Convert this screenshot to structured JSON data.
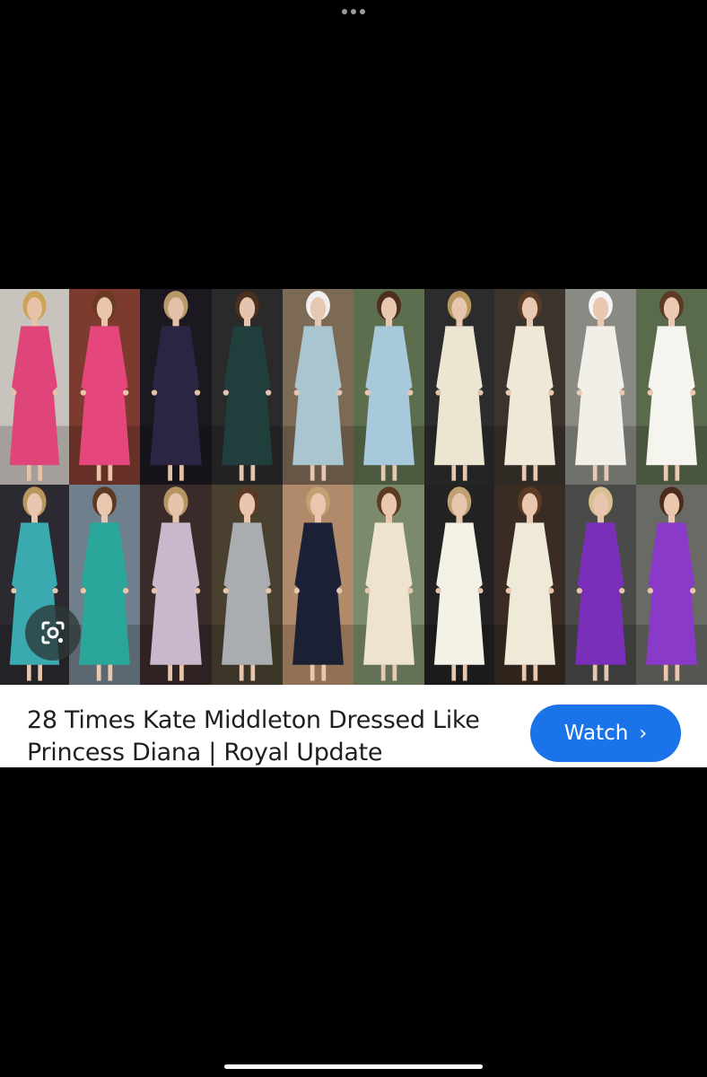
{
  "browser": {
    "menu_icon": "more-dots-icon"
  },
  "result": {
    "title": "28 Times Kate Middleton Dressed Like Princess Diana | Royal Update",
    "watch_label": "Watch",
    "watch_chevron": "›",
    "lens_icon": "google-lens-icon"
  },
  "collage": {
    "top_row": [
      {
        "bg": "#c9c3bd",
        "dress": "#e0457a",
        "skin": "#e8c2a8",
        "hair": "#c9a45a"
      },
      {
        "bg": "#7d3b2f",
        "dress": "#e5467c",
        "skin": "#eac5ac",
        "hair": "#6b3a22"
      },
      {
        "bg": "#1c1820",
        "dress": "#2a2542",
        "skin": "#e3c0a8",
        "hair": "#b89a68"
      },
      {
        "bg": "#2a2a2a",
        "dress": "#1f3e3c",
        "skin": "#e4c4ae",
        "hair": "#4a2e1e"
      },
      {
        "bg": "#7c6a55",
        "dress": "#a9c5cf",
        "skin": "#e6c7b2",
        "hair": "#efefef"
      },
      {
        "bg": "#5c6e4e",
        "dress": "#a8c9dc",
        "skin": "#e8c8b0",
        "hair": "#4e2f1e"
      },
      {
        "bg": "#2c2c2c",
        "dress": "#ece5d2",
        "skin": "#e6c6ae",
        "hair": "#b8955c"
      },
      {
        "bg": "#3a342c",
        "dress": "#efe8d6",
        "skin": "#eac9b2",
        "hair": "#5a3a26"
      },
      {
        "bg": "#8a8a84",
        "dress": "#f2efe8",
        "skin": "#e8c8b0",
        "hair": "#f4f4f4"
      },
      {
        "bg": "#5a6a4c",
        "dress": "#f6f4ef",
        "skin": "#ecc9b0",
        "hair": "#5c3a24"
      }
    ],
    "bottom_row": [
      {
        "bg": "#2a2a30",
        "dress": "#3aaab0",
        "skin": "#e6c6ae",
        "hair": "#b8955c"
      },
      {
        "bg": "#6f7f8c",
        "dress": "#2aa69a",
        "skin": "#eac8b0",
        "hair": "#5c3a24"
      },
      {
        "bg": "#3a2a2a",
        "dress": "#c9b8cc",
        "skin": "#e6c4ac",
        "hair": "#b89560"
      },
      {
        "bg": "#4a4030",
        "dress": "#a9adb0",
        "skin": "#e8c6ae",
        "hair": "#5a3a26"
      },
      {
        "bg": "#b08a6a",
        "dress": "#1c2034",
        "skin": "#eac6ae",
        "hair": "#c2a070"
      },
      {
        "bg": "#7a8a6a",
        "dress": "#eee3cf",
        "skin": "#eac8b0",
        "hair": "#5c3a24"
      },
      {
        "bg": "#222222",
        "dress": "#f4f1e6",
        "skin": "#e6c6ae",
        "hair": "#c0a070"
      },
      {
        "bg": "#3a2c22",
        "dress": "#efe9d8",
        "skin": "#eac8b0",
        "hair": "#5c3a24"
      },
      {
        "bg": "#4a4a48",
        "dress": "#7a2fb8",
        "skin": "#e6c6ae",
        "hair": "#d8c090"
      },
      {
        "bg": "#6a6a64",
        "dress": "#8a3ac8",
        "skin": "#eac8b0",
        "hair": "#4a2c1c"
      }
    ]
  }
}
